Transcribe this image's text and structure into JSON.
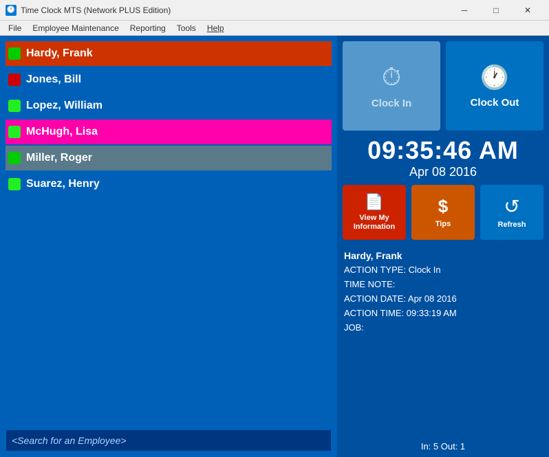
{
  "titlebar": {
    "icon": "🕐",
    "title": "Time Clock MTS (Network PLUS Edition)",
    "minimize": "─",
    "maximize": "□",
    "close": "✕"
  },
  "menu": {
    "file": "File",
    "employee_maintenance": "Employee Maintenance",
    "reporting": "Reporting",
    "tools": "Tools",
    "help": "Help"
  },
  "employees": [
    {
      "name": "Hardy, Frank",
      "status": "green",
      "rowStyle": "selected-orange"
    },
    {
      "name": "Jones, Bill",
      "status": "red",
      "rowStyle": ""
    },
    {
      "name": "Lopez, William",
      "status": "green-bright",
      "rowStyle": ""
    },
    {
      "name": "McHugh, Lisa",
      "status": "green-bright",
      "rowStyle": "selected-pink"
    },
    {
      "name": "Miller, Roger",
      "status": "green",
      "rowStyle": "selected-gray"
    },
    {
      "name": "Suarez, Henry",
      "status": "green-bright",
      "rowStyle": ""
    }
  ],
  "search": {
    "placeholder": "<Search for an Employee>"
  },
  "clock_in": {
    "label": "Clock In",
    "icon": "⏱"
  },
  "clock_out": {
    "label": "Clock Out",
    "icon": "🕐"
  },
  "time": {
    "current": "09:35:46 AM",
    "date": "Apr 08 2016"
  },
  "actions": {
    "view_info": {
      "label": "View My\nInformation",
      "icon": "📄"
    },
    "tips": {
      "label": "Tips",
      "icon": "$"
    },
    "refresh": {
      "label": "Refresh",
      "icon": "↺"
    }
  },
  "last_action": {
    "employee": "Hardy, Frank",
    "action_type": "ACTION TYPE: Clock In",
    "time_note": "TIME NOTE:",
    "action_date": "ACTION DATE: Apr 08 2016",
    "action_time": "ACTION TIME: 09:33:19 AM",
    "job": "JOB:"
  },
  "summary": {
    "text": "In: 5  Out: 1"
  }
}
